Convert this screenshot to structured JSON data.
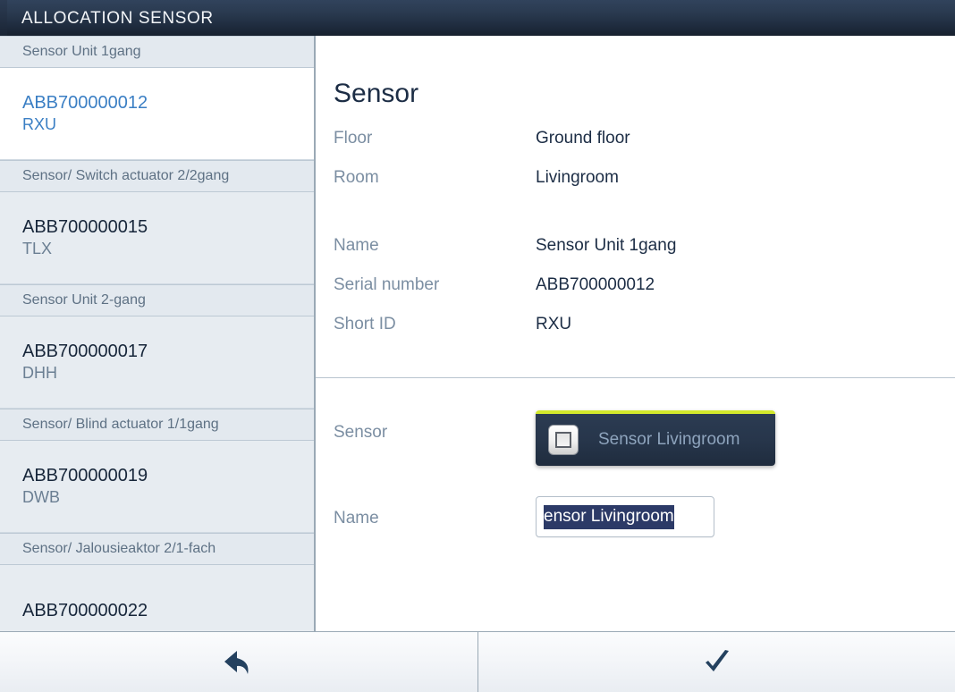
{
  "header": {
    "title": "ALLOCATION SENSOR"
  },
  "sidebar": {
    "entries": [
      {
        "kind": "group",
        "label": "Sensor Unit 1gang"
      },
      {
        "kind": "device",
        "serial": "ABB700000012",
        "short_id": "RXU",
        "selected": true
      },
      {
        "kind": "group",
        "label": "Sensor/ Switch actuator 2/2gang"
      },
      {
        "kind": "device",
        "serial": "ABB700000015",
        "short_id": "TLX",
        "selected": false
      },
      {
        "kind": "group",
        "label": "Sensor Unit 2-gang"
      },
      {
        "kind": "device",
        "serial": "ABB700000017",
        "short_id": "DHH",
        "selected": false
      },
      {
        "kind": "group",
        "label": "Sensor/ Blind actuator 1/1gang"
      },
      {
        "kind": "device",
        "serial": "ABB700000019",
        "short_id": "DWB",
        "selected": false
      },
      {
        "kind": "group",
        "label": "Sensor/ Jalousieaktor 2/1-fach"
      },
      {
        "kind": "device",
        "serial": "ABB700000022",
        "short_id": "",
        "selected": false
      }
    ]
  },
  "main": {
    "title": "Sensor",
    "details": [
      {
        "label": "Floor",
        "value": "Ground floor"
      },
      {
        "label": "Room",
        "value": "Livingroom"
      },
      {
        "label": "Name",
        "value": "Sensor Unit 1gang"
      },
      {
        "label": "Serial number",
        "value": "ABB700000012"
      },
      {
        "label": "Short ID",
        "value": "RXU"
      }
    ],
    "sensor_control": {
      "label": "Sensor",
      "chip_label": "Sensor Livingroom",
      "chip_icon": "rocker-switch-icon",
      "chip_accent_color": "#d2e82b"
    },
    "name_control": {
      "label": "Name",
      "value": "ensor Livingroom",
      "placeholder": "",
      "selected": true
    }
  },
  "footer": {
    "back_button": {
      "icon": "back-arrow-icon"
    },
    "confirm_button": {
      "icon": "checkmark-icon"
    }
  }
}
